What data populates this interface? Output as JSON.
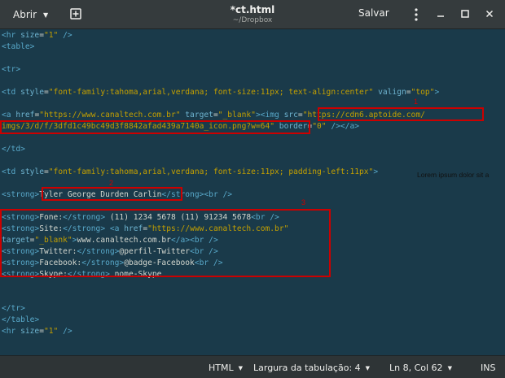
{
  "header": {
    "open_label": "Abrir",
    "title": "*ct.html",
    "subtitle": "~/Dropbox",
    "save_label": "Salvar"
  },
  "editor": {
    "lines": [
      [
        [
          "t",
          "<hr "
        ],
        [
          "a",
          "size"
        ],
        [
          "p",
          "="
        ],
        [
          "s",
          "\"1\""
        ],
        [
          "t",
          " />"
        ]
      ],
      [
        [
          "t",
          "<table>"
        ]
      ],
      [],
      [
        [
          "t",
          "<tr>"
        ]
      ],
      [],
      [
        [
          "t",
          "<td "
        ],
        [
          "a",
          "style"
        ],
        [
          "p",
          "="
        ],
        [
          "s",
          "\"font-family:tahoma,arial,verdana; font-size:11px; text-align:center\""
        ],
        [
          "a",
          " valign"
        ],
        [
          "p",
          "="
        ],
        [
          "s",
          "\"top\""
        ],
        [
          "t",
          ">"
        ]
      ],
      [],
      [
        [
          "t",
          "<a "
        ],
        [
          "a",
          "href"
        ],
        [
          "p",
          "="
        ],
        [
          "s",
          "\"https://www.canaltech.com.br\""
        ],
        [
          "a",
          " target"
        ],
        [
          "p",
          "="
        ],
        [
          "s",
          "\"_blank\""
        ],
        [
          "t",
          "><img "
        ],
        [
          "a",
          "src"
        ],
        [
          "p",
          "="
        ],
        [
          "s",
          "\"https://cdn6.aptoide.com/"
        ]
      ],
      [
        [
          "s",
          "imgs/3/d/f/3dfd1c49bc49d3f8842afad439a7140a_icon.png?w=64\""
        ],
        [
          "a",
          " border"
        ],
        [
          "p",
          "="
        ],
        [
          "s",
          "\"0\""
        ],
        [
          "t",
          " /></a>"
        ]
      ],
      [],
      [
        [
          "t",
          "</td>"
        ]
      ],
      [],
      [
        [
          "t",
          "<td "
        ],
        [
          "a",
          "style"
        ],
        [
          "p",
          "="
        ],
        [
          "s",
          "\"font-family:tahoma,arial,verdana; font-size:11px; padding-left:11px\""
        ],
        [
          "t",
          ">"
        ]
      ],
      [],
      [
        [
          "t",
          "<strong>"
        ],
        [
          "p",
          "Tyler George Durden Carlin"
        ],
        [
          "t",
          "</strong><br />"
        ]
      ],
      [],
      [
        [
          "t",
          "<strong>"
        ],
        [
          "p",
          "Fone:"
        ],
        [
          "t",
          "</strong>"
        ],
        [
          "p",
          " (11) 1234 5678 (11) 91234 5678"
        ],
        [
          "t",
          "<br />"
        ]
      ],
      [
        [
          "t",
          "<strong>"
        ],
        [
          "p",
          "Site:"
        ],
        [
          "t",
          "</strong> <a "
        ],
        [
          "a",
          "href"
        ],
        [
          "p",
          "="
        ],
        [
          "s",
          "\"https://www.canaltech.com.br\""
        ]
      ],
      [
        [
          "a",
          "target"
        ],
        [
          "p",
          "="
        ],
        [
          "s",
          "\"_blank\""
        ],
        [
          "t",
          ">"
        ],
        [
          "p",
          "www.canaltech.com.br"
        ],
        [
          "t",
          "</a><br />"
        ]
      ],
      [
        [
          "t",
          "<strong>"
        ],
        [
          "p",
          "Twitter:"
        ],
        [
          "t",
          "</strong>"
        ],
        [
          "p",
          "@perfil-Twitter"
        ],
        [
          "t",
          "<br />"
        ]
      ],
      [
        [
          "t",
          "<strong>"
        ],
        [
          "p",
          "Facebook:"
        ],
        [
          "t",
          "</strong>"
        ],
        [
          "p",
          "@badge-Facebook"
        ],
        [
          "t",
          "<br />"
        ]
      ],
      [
        [
          "t",
          "<strong>"
        ],
        [
          "p",
          "Skype:"
        ],
        [
          "t",
          "</strong>"
        ],
        [
          "p",
          " nome-Skype"
        ]
      ],
      [],
      [],
      [
        [
          "t",
          "</tr>"
        ]
      ],
      [
        [
          "t",
          "</table>"
        ]
      ],
      [
        [
          "t",
          "<hr "
        ],
        [
          "a",
          "size"
        ],
        [
          "p",
          "="
        ],
        [
          "s",
          "\"1\""
        ],
        [
          "t",
          " />"
        ]
      ]
    ],
    "overflow_text": "Lorem ipsum dolor sit a",
    "annotations": [
      "1",
      "2",
      "3"
    ]
  },
  "status": {
    "language": "HTML",
    "tab_width": "Largura da tabulação: 4",
    "position": "Ln 8, Col 62",
    "mode": "INS"
  },
  "colors": {
    "background": "#1a3a4a",
    "tag": "#58a8c9",
    "string": "#c4a000",
    "annotation": "#cc0000"
  }
}
